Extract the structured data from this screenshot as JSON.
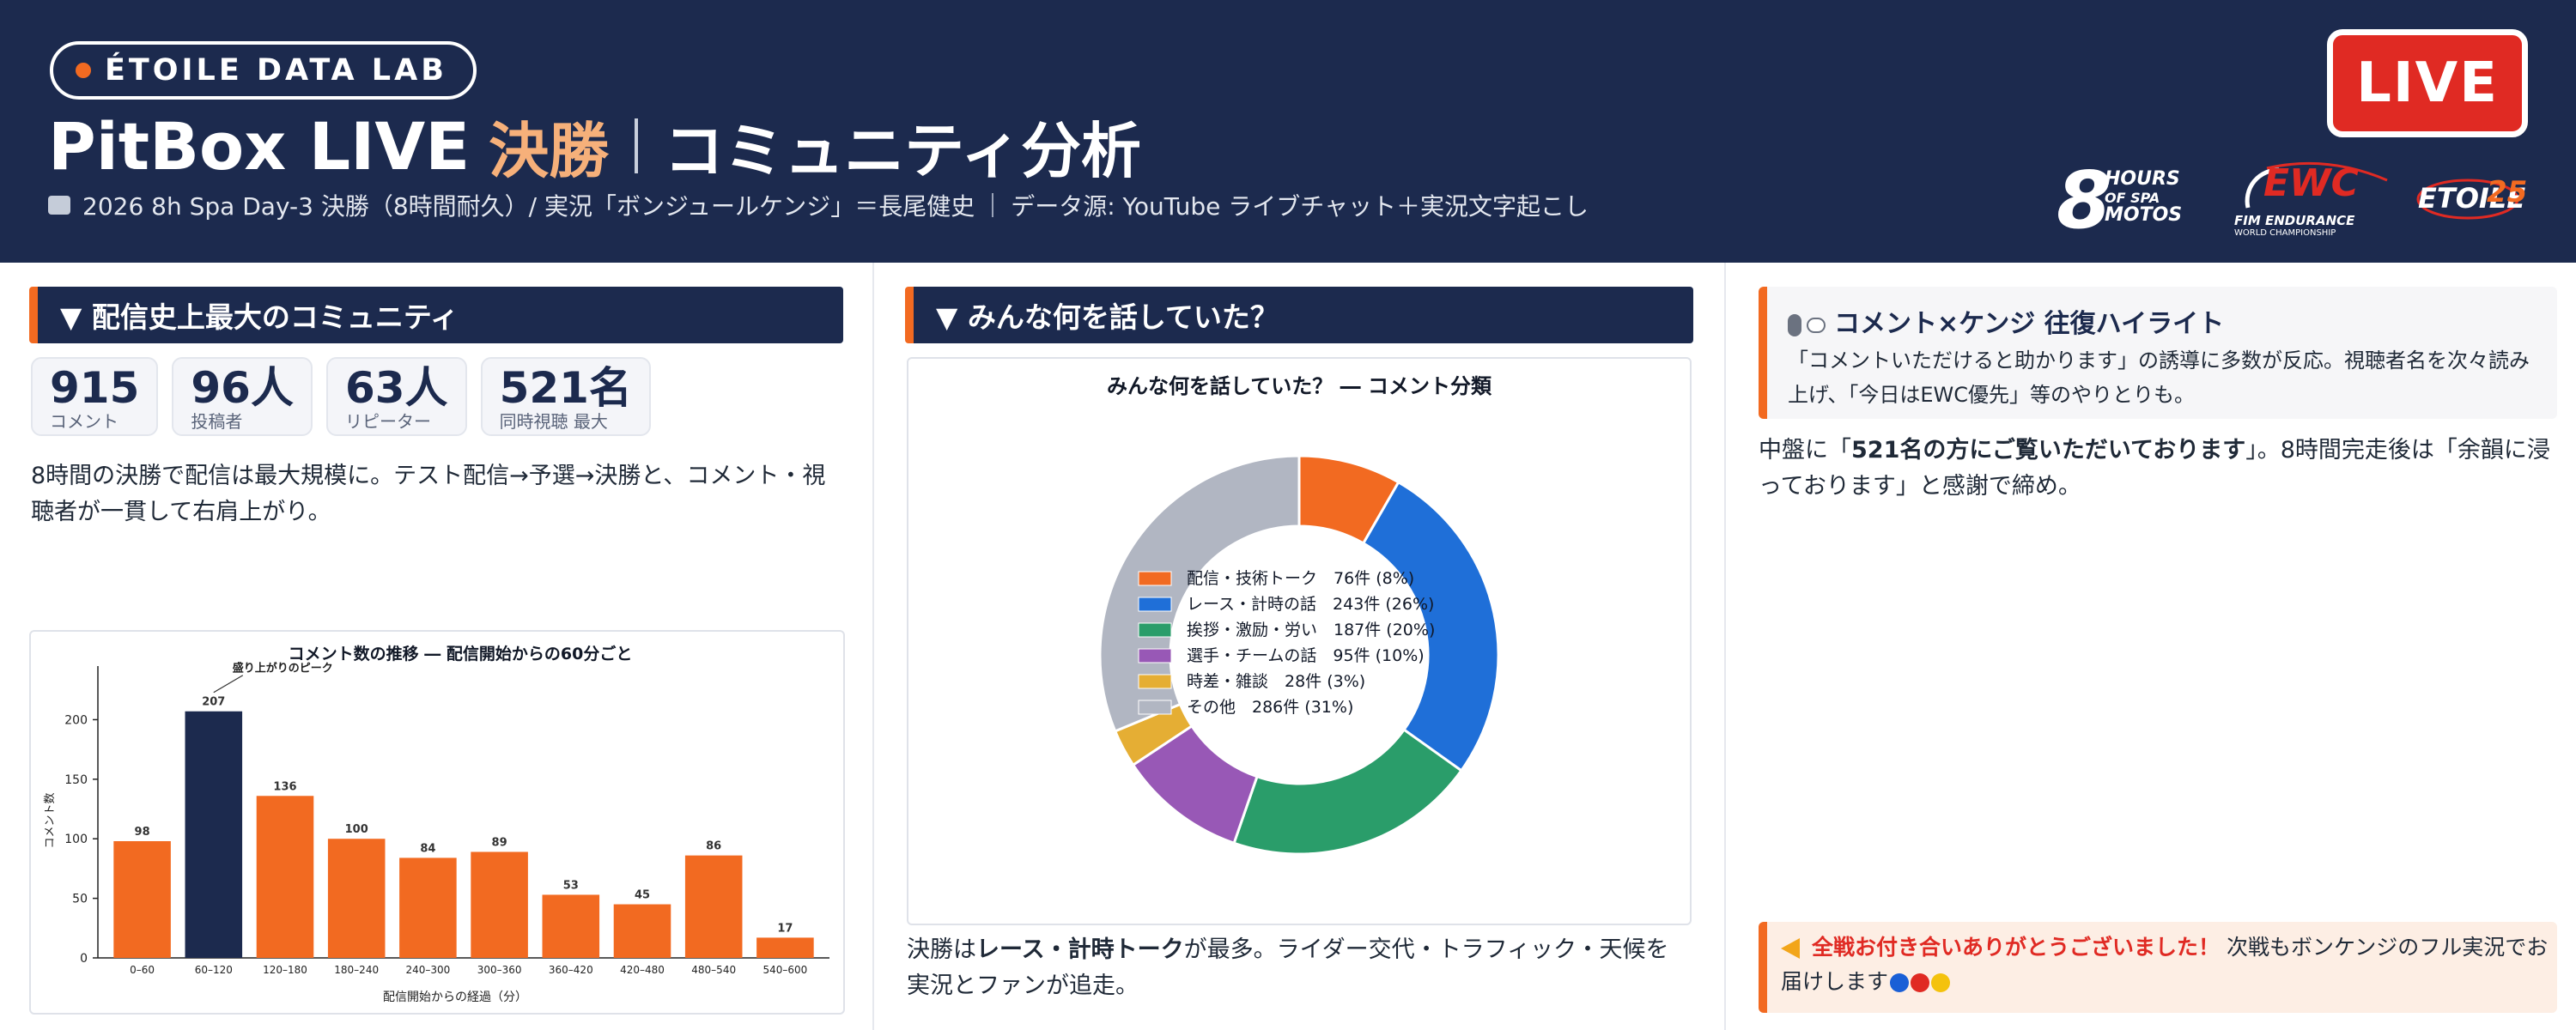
{
  "header": {
    "brand": "ÉTOILE DATA LAB",
    "title_main": "PitBox LIVE",
    "title_accent": "決勝",
    "title_sub": "コミュニティ分析",
    "subline_event": "2026 8h Spa Day-3 決勝（8時間耐久）/ 実況「ボンジュールケンジ」＝長尾健史",
    "subline_source": "データ源: YouTube ライブチャット＋実況文字起こし",
    "live_label": "LIVE",
    "logo_8h_num": "8",
    "logo_8h_words": [
      "HOURS",
      "OF SPA",
      "MOTOS"
    ],
    "logo_ewc": "EWC",
    "logo_ewc_sub": "FIM ENDURANCE",
    "logo_ewc_sub2": "WORLD CHAMPIONSHIP",
    "logo_etoile": "ETOILE",
    "logo_etoile_num": "25"
  },
  "left": {
    "section_title": "▼ 配信史上最大のコミュニティ",
    "stats": [
      {
        "value": "915",
        "label": "コメント"
      },
      {
        "value": "96人",
        "label": "投稿者"
      },
      {
        "value": "63人",
        "label": "リピーター"
      },
      {
        "value": "521名",
        "label": "同時視聴 最大"
      }
    ],
    "paragraph": "8時間の決勝で配信は最大規模に。テスト配信→予選→決勝と、コメント・視聴者が一貫して右肩上がり。"
  },
  "middle": {
    "section_title": "▼ みんな何を話していた？",
    "para_pre": "決勝は",
    "para_bold": "レース・計時トーク",
    "para_post": "が最多。ライダー交代・トラフィック・天候を実況とファンが追走。"
  },
  "right": {
    "callout_title": "コメント×ケンジ 往復ハイライト",
    "callout_body": "「コメントいただけると助かります」の誘導に多数が反応。視聴者名を次々読み上げ、「今日はEWC優先」等のやりとりも。",
    "para_pre": "中盤に「",
    "para_bold": "521名の方にご覧いただいております",
    "para_post": "」。8時間完走後は「余韻に浸っております」と感謝で締め。",
    "thanks_red": "全戦お付き合いありがとうございました！",
    "thanks_rest": "次戦もボンケンジのフル実況でお届けします"
  },
  "colors": {
    "navy": "#1c2a4e",
    "orange": "#f26a21",
    "live_red": "#e02a23",
    "peach": "#f6b07a",
    "thanks_dots": [
      "#1a5fd6",
      "#e02a23",
      "#f4c20d"
    ]
  },
  "chart_data": [
    {
      "type": "bar",
      "title": "コメント数の推移 ― 配信開始からの60分ごと",
      "xlabel": "配信開始からの経過（分）",
      "ylabel": "コメント数",
      "categories": [
        "0–60",
        "60–120",
        "120–180",
        "180–240",
        "240–300",
        "300–360",
        "360–420",
        "420–480",
        "480–540",
        "540–600"
      ],
      "values": [
        98,
        207,
        136,
        100,
        84,
        89,
        53,
        45,
        86,
        17
      ],
      "highlight_index": 1,
      "annotation": "盛り上がりのピーク",
      "ylim": [
        0,
        245
      ],
      "yticks": [
        0,
        50,
        100,
        150,
        200
      ],
      "colors": {
        "bar": "#f26a21",
        "highlight": "#1c2a4e"
      }
    },
    {
      "type": "pie",
      "donut": true,
      "title": "みんな何を話していた？ ― コメント分類",
      "legend_position": "center",
      "slices": [
        {
          "label": "配信・技術トーク",
          "count_text": "76件",
          "percent_text": "(8%)",
          "value": 76,
          "color": "#f26a21"
        },
        {
          "label": "レース・計時の話",
          "count_text": "243件",
          "percent_text": "(26%)",
          "value": 243,
          "color": "#1f6fd8"
        },
        {
          "label": "挨拶・激励・労い",
          "count_text": "187件",
          "percent_text": "(20%)",
          "value": 187,
          "color": "#2a9d6a"
        },
        {
          "label": "選手・チームの話",
          "count_text": "95件",
          "percent_text": "(10%)",
          "value": 95,
          "color": "#9858b6"
        },
        {
          "label": "時差・雑談",
          "count_text": "28件",
          "percent_text": "(3%)",
          "value": 28,
          "color": "#e5ae34"
        },
        {
          "label": "その他",
          "count_text": "286件",
          "percent_text": "(31%)",
          "value": 286,
          "color": "#b1b6c2"
        }
      ]
    }
  ]
}
